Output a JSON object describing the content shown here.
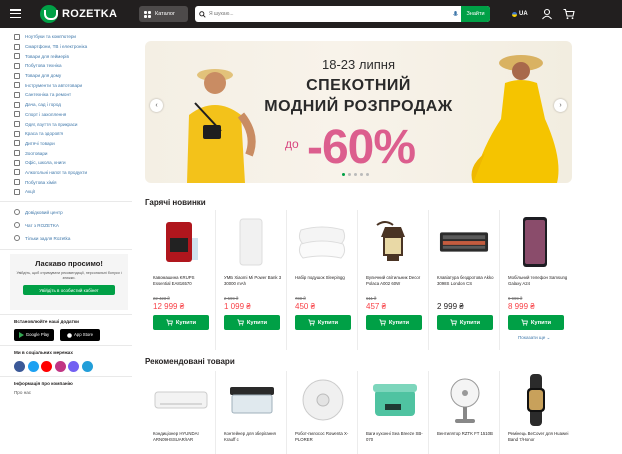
{
  "header": {
    "logo_text": "ROZETKA",
    "catalog_label": "Каталог",
    "search_placeholder": "Я шукаю...",
    "search_button": "Знайти",
    "lang": "UA",
    "brand_color": "#00a046",
    "header_bg": "#221f1f"
  },
  "sidebar": {
    "categories": [
      {
        "label": "Ноутбуки та комп'ютери",
        "icon": "laptop-icon"
      },
      {
        "label": "Смартфони, ТВ і електроніка",
        "icon": "smartphone-icon"
      },
      {
        "label": "Товари для геймерів",
        "icon": "gamepad-icon"
      },
      {
        "label": "Побутова техніка",
        "icon": "appliance-icon"
      },
      {
        "label": "Товари для дому",
        "icon": "home-icon"
      },
      {
        "label": "Інструменти та автотовари",
        "icon": "tools-icon"
      },
      {
        "label": "Сантехніка та ремонт",
        "icon": "faucet-icon"
      },
      {
        "label": "Дача, сад і город",
        "icon": "garden-icon"
      },
      {
        "label": "Спорт і захоплення",
        "icon": "sport-icon"
      },
      {
        "label": "Одяг, взуття та прикраси",
        "icon": "clothes-icon"
      },
      {
        "label": "Краса та здоров'я",
        "icon": "beauty-icon"
      },
      {
        "label": "Дитячі товари",
        "icon": "kids-icon"
      },
      {
        "label": "Зоотовари",
        "icon": "paw-icon"
      },
      {
        "label": "Офіс, школа, книги",
        "icon": "book-icon"
      },
      {
        "label": "Алкогольні напої та продукти",
        "icon": "wine-icon"
      },
      {
        "label": "Побутова хімія",
        "icon": "chemistry-icon"
      },
      {
        "label": "Акції",
        "icon": "percent-icon"
      }
    ],
    "services": [
      {
        "label": "Довідковий центр",
        "icon": "info-icon"
      },
      {
        "label": "Чат з ROZETKA",
        "icon": "telegram-icon"
      },
      {
        "label": "Тільки задля Rozetka",
        "icon": "shop-icon"
      }
    ],
    "welcome": {
      "title": "Ласкаво просимо!",
      "description": "Увійдіть, щоб отримувати рекомендації, персональні бонуси і знижки.",
      "button": "Увійдіть в особистий кабінет"
    },
    "apps_heading": "Встановлюйте наші додатки",
    "google_play": "Google Play",
    "app_store": "App Store",
    "social_heading": "Ми в соціальних мережах",
    "company_heading": "Інформація про компанію",
    "about_link": "Про нас"
  },
  "banner": {
    "dates": "18-23 липня",
    "line1": "СПЕКОТНИЙ",
    "line2": "МОДНИЙ РОЗПРОДАЖ",
    "prefix": "до",
    "discount": "-60%",
    "dots_count": 5,
    "active_dot": 0
  },
  "hot_new": {
    "title": "Гарячі новинки",
    "buy_label": "Купити",
    "more_label": "Показати ще",
    "products": [
      {
        "name": "Кавомашина KRUPS Essential EA816570",
        "old_price": "22 423 ₴",
        "price": "12 999 ₴",
        "sale": true,
        "icon": "coffee-machine-icon"
      },
      {
        "name": "УМБ Xiaomi Mi Power Bank 3 30000 mAh",
        "old_price": "2 599 ₴",
        "price": "1 099 ₴",
        "sale": true,
        "icon": "powerbank-icon"
      },
      {
        "name": "Набір подушок Sleepingg",
        "old_price": "700 ₴",
        "price": "450 ₴",
        "sale": true,
        "icon": "pillow-icon"
      },
      {
        "name": "Вуличний світильник Decor Polaca A002 60W",
        "old_price": "611 ₴",
        "price": "457 ₴",
        "sale": true,
        "icon": "lantern-icon"
      },
      {
        "name": "Клавіатура бездротова Akko 3098S London CS",
        "old_price": "",
        "price": "2 999 ₴",
        "sale": false,
        "icon": "keyboard-icon"
      },
      {
        "name": "Мобільний телефон Samsung Galaxy A24",
        "old_price": "9 999 ₴",
        "price": "8 999 ₴",
        "sale": true,
        "icon": "phone-icon"
      }
    ]
  },
  "recommended": {
    "title": "Рекомендовані товари",
    "products": [
      {
        "name": "Кондиціонер HYUNDAI ARN09HSSUAR/IAR",
        "icon": "air-conditioner-icon"
      },
      {
        "name": "Контейнер для зберігання Krauff с",
        "icon": "container-icon"
      },
      {
        "name": "Робот-пилосос Rowenta X-PLORER",
        "icon": "robot-vacuum-icon"
      },
      {
        "name": "Ваги кухонні Sea Breeze SB-070",
        "icon": "scale-icon"
      },
      {
        "name": "Вентилятор RZTK FT 1510B",
        "icon": "fan-icon"
      },
      {
        "name": "Ремінець BeCover для Huawei Band 7/Honor",
        "icon": "watch-band-icon"
      }
    ]
  }
}
